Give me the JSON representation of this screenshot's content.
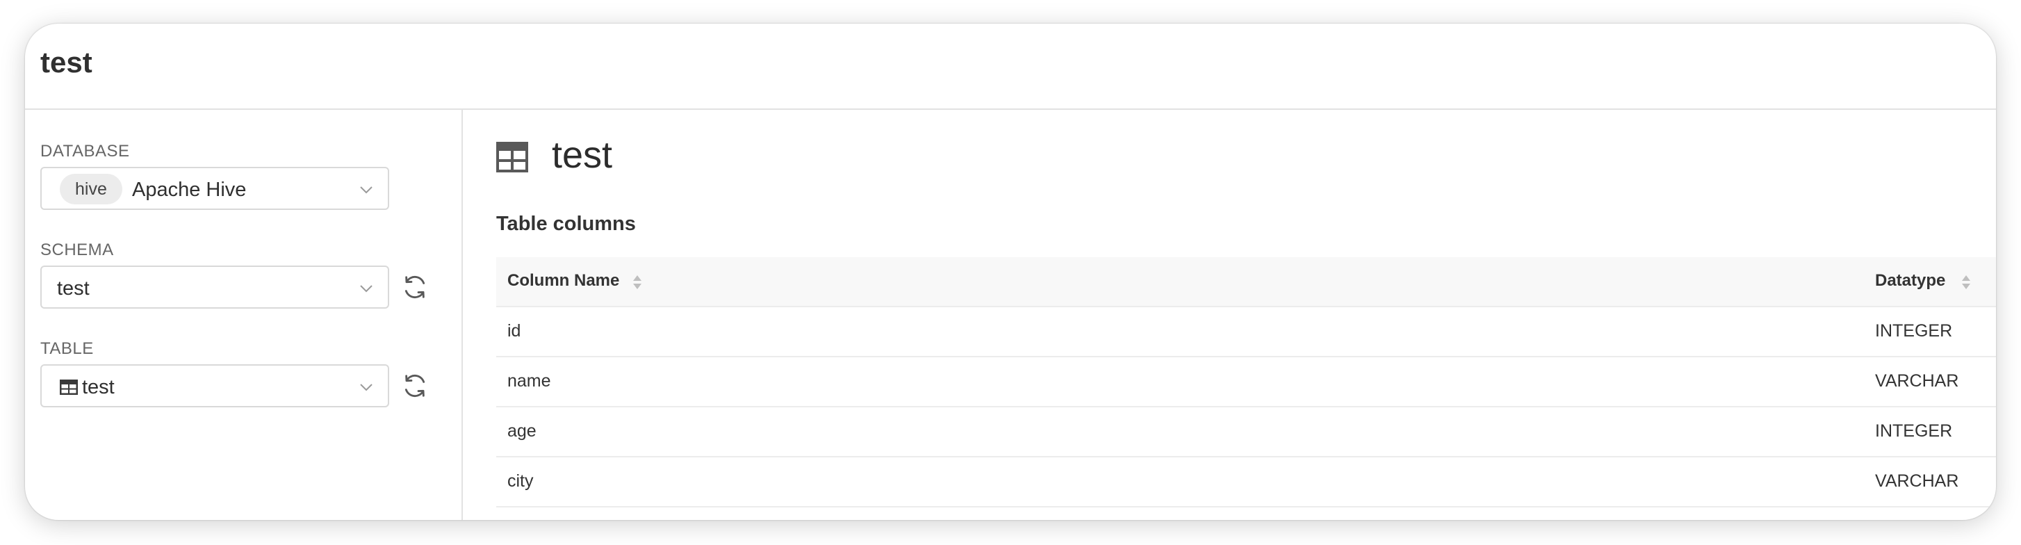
{
  "header": {
    "title": "test"
  },
  "sidebar": {
    "database": {
      "label": "DATABASE",
      "badge": "hive",
      "value": "Apache Hive"
    },
    "schema": {
      "label": "SCHEMA",
      "value": "test"
    },
    "table": {
      "label": "TABLE",
      "value": "test"
    }
  },
  "main": {
    "title": "test",
    "section_title": "Table columns",
    "columns": [
      "Column Name",
      "Datatype"
    ],
    "rows": [
      {
        "name": "id",
        "type": "INTEGER"
      },
      {
        "name": "name",
        "type": "VARCHAR"
      },
      {
        "name": "age",
        "type": "INTEGER"
      },
      {
        "name": "city",
        "type": "VARCHAR"
      }
    ]
  },
  "icons": {
    "refresh": "refresh-icon",
    "table": "table-icon",
    "chevron": "chevron-down-icon",
    "sort": "sort-icon"
  },
  "colors": {
    "border": "#d9d9d9",
    "header_bg": "#f8f8f8",
    "icon": "#595959",
    "badge_bg": "#ececec"
  }
}
